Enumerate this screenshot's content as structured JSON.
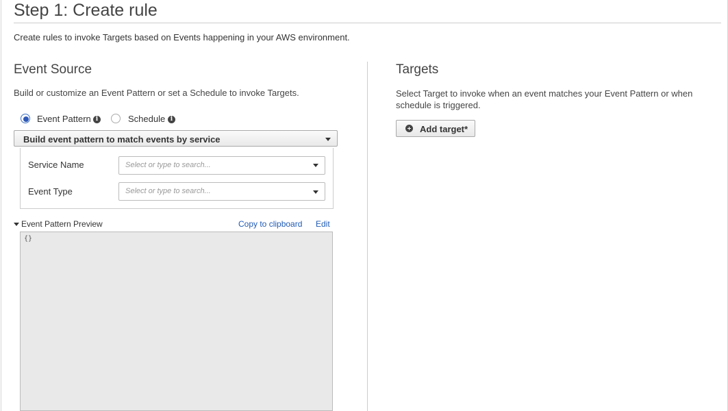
{
  "page": {
    "title": "Step 1: Create rule",
    "description": "Create rules to invoke Targets based on Events happening in your AWS environment."
  },
  "event_source": {
    "title": "Event Source",
    "description": "Build or customize an Event Pattern or set a Schedule to invoke Targets.",
    "radio_options": [
      {
        "label": "Event Pattern",
        "checked": true
      },
      {
        "label": "Schedule",
        "checked": false
      }
    ],
    "pattern_mode": "Build event pattern to match events by service",
    "fields": [
      {
        "label": "Service Name",
        "placeholder": "Select or type to search..."
      },
      {
        "label": "Event Type",
        "placeholder": "Select or type to search..."
      }
    ],
    "preview": {
      "label": "Event Pattern Preview",
      "copy_label": "Copy to clipboard",
      "edit_label": "Edit",
      "content": "{}"
    }
  },
  "targets": {
    "title": "Targets",
    "description": "Select Target to invoke when an event matches your Event Pattern or when schedule is triggered.",
    "add_button": "Add target*"
  },
  "colors": {
    "accent": "#2f59b7",
    "link": "#1f5ab5",
    "preview_bg": "#e9e9e9"
  }
}
